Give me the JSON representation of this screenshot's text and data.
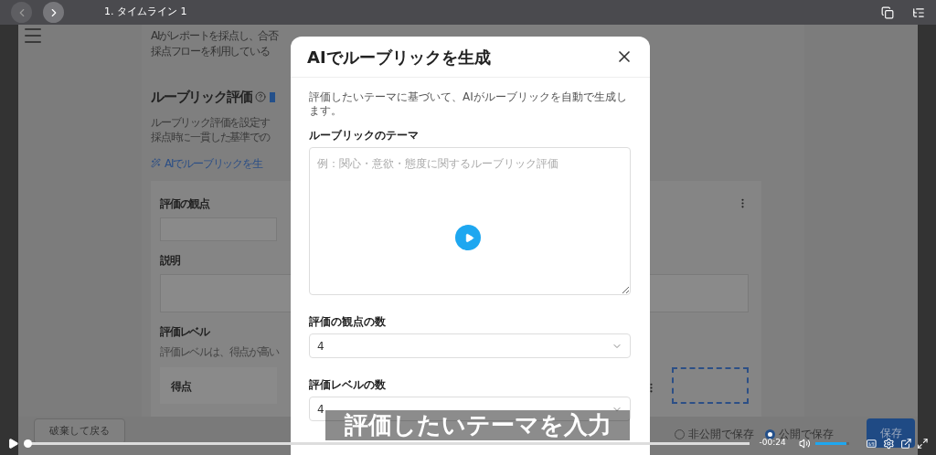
{
  "player": {
    "title": "1. タイムライン 1",
    "time_remaining": "-00:24",
    "progress": {
      "level": 0
    },
    "volume": {
      "level": 0.9
    },
    "caption": "評価したいテーマを入力"
  },
  "page": {
    "intro_lines": [
      "AIがレポートを採点し、合否",
      "採点フローを利用している"
    ],
    "section_title": "ルーブリック評価",
    "section_description": [
      "ルーブリック評価を設定す",
      "採点時に一貫した基準での"
    ],
    "ai_link": "AIでルーブリックを生",
    "card": {
      "fields": [
        {
          "label": "評価の観点",
          "kind": "input"
        },
        {
          "label": "説明",
          "kind": "textarea"
        }
      ],
      "levels": {
        "title": "評価レベル",
        "hint": "評価レベルは、得点が高い",
        "column": "得点"
      }
    },
    "footer": {
      "back_button": "破棄して戻る",
      "visibility": [
        {
          "label": "非公開で保存",
          "selected": false
        },
        {
          "label": "公開で保存",
          "selected": true
        }
      ],
      "save_button": "保存"
    }
  },
  "modal": {
    "title": "AIでルーブリックを生成",
    "description": "評価したいテーマに基づいて、AIがルーブリックを自動で生成します。",
    "theme": {
      "label": "ルーブリックのテーマ",
      "placeholder": "例：関心・意欲・態度に関するルーブリック評価"
    },
    "selects": [
      {
        "label": "評価の観点の数",
        "value": "4"
      },
      {
        "label": "評価レベルの数",
        "value": "4"
      }
    ]
  }
}
